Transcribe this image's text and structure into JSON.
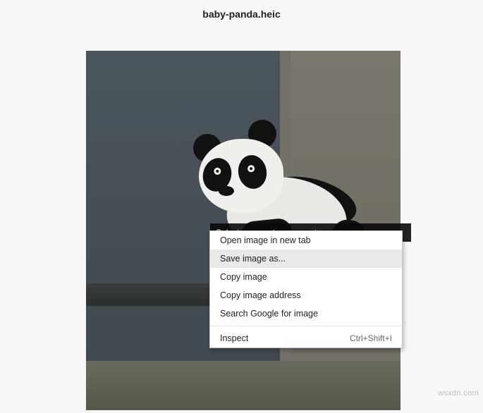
{
  "title": "baby-panda.heic",
  "caption_hint": "Select an area to comment on",
  "context_menu": {
    "items": [
      {
        "label": "Open image in new tab",
        "shortcut": ""
      },
      {
        "label": "Save image as...",
        "shortcut": ""
      },
      {
        "label": "Copy image",
        "shortcut": ""
      },
      {
        "label": "Copy image address",
        "shortcut": ""
      },
      {
        "label": "Search Google for image",
        "shortcut": ""
      }
    ],
    "inspect": {
      "label": "Inspect",
      "shortcut": "Ctrl+Shift+I"
    },
    "hover_index": 1
  },
  "watermark": "wsxdn.com"
}
